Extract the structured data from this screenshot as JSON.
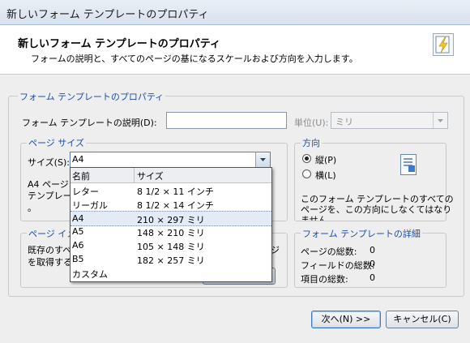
{
  "window": {
    "title": "新しいフォーム テンプレートのプロパティ"
  },
  "header": {
    "title": "新しいフォーム テンプレートのプロパティ",
    "description": "フォームの説明と、すべてのページの基になるスケールおよび方向を入力します。",
    "icon": "wizard-wand-icon"
  },
  "template_props": {
    "legend": "フォーム テンプレートのプロパティ",
    "desc_label": "フォーム テンプレートの説明(D):",
    "desc_value": "",
    "unit_label": "単位(U):",
    "unit_value": "ミリ"
  },
  "page_size": {
    "legend": "ページ サイズ",
    "size_label": "サイズ(S):",
    "size_value": "A4",
    "desc_line1": "A4 ページ",
    "desc_line2": "テンプレート",
    "desc_line3": "。"
  },
  "dropdown": {
    "col_name": "名前",
    "col_size": "サイズ",
    "rows": [
      {
        "name": "レター",
        "size": "8 1/2 × 11 インチ"
      },
      {
        "name": "リーガル",
        "size": "8 1/2 × 14 インチ"
      },
      {
        "name": "A4",
        "size": "210 × 297 ミリ"
      },
      {
        "name": "A5",
        "size": "148 × 210 ミリ"
      },
      {
        "name": "A6",
        "size": "105 × 148 ミリ"
      },
      {
        "name": "B5",
        "size": "182 × 257 ミリ"
      },
      {
        "name": "カスタム",
        "size": ""
      }
    ],
    "selected": "A4"
  },
  "orientation": {
    "legend": "方向",
    "portrait": "縦(P)",
    "landscape": "横(L)",
    "selected": "portrait",
    "note1": "このフォーム テンプレートのすべての",
    "note2": "ページを、この方向にしなくてはなり",
    "note3": "ません。"
  },
  "page_image": {
    "legend": "ページ イメ",
    "line1": "既存のすべ",
    "line2": "を取得する",
    "hidden_right": "ジ"
  },
  "details": {
    "legend": "フォーム テンプレートの詳細",
    "rows": [
      {
        "label": "ページの総数:",
        "value": "0"
      },
      {
        "label": "フィールドの総数:",
        "value": "0"
      },
      {
        "label": "項目の総数:",
        "value": "0"
      }
    ]
  },
  "buttons": {
    "next": "次へ(N) >>",
    "cancel": "キャンセル(C)"
  }
}
